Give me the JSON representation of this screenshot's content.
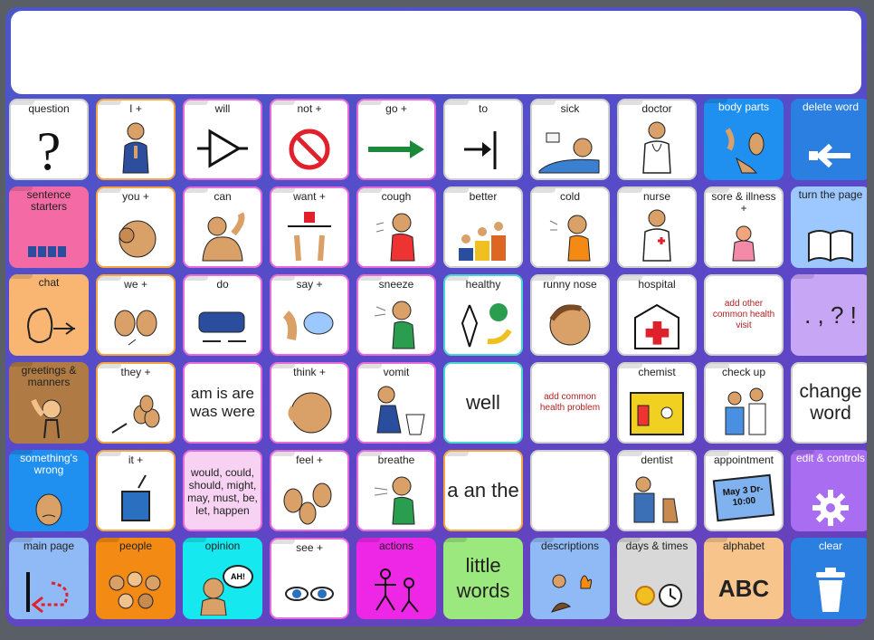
{
  "message_bar": {
    "text": ""
  },
  "cells": {
    "r1": [
      "question",
      "I +",
      "will",
      "not +",
      "go +",
      "to",
      "sick",
      "doctor",
      "body parts",
      "delete word"
    ],
    "r2": [
      "sentence starters",
      "you +",
      "can",
      "want +",
      "cough",
      "better",
      "cold",
      "nurse",
      "sore & illness +",
      "turn the page"
    ],
    "r3": [
      "chat",
      "we +",
      "do",
      "say +",
      "sneeze",
      "healthy",
      "runny nose",
      "hospital",
      "add other common health visit",
      ". , ? !"
    ],
    "r4": [
      "greetings & manners",
      "they +",
      "am is are was were",
      "think +",
      "vomit",
      "well",
      "add common health problem",
      "chemist",
      "check up",
      "change word"
    ],
    "r5": [
      "something's wrong",
      "it +",
      "would, could, should, might, may, must, be, let, happen",
      "feel +",
      "breathe",
      "a an the",
      "",
      "dentist",
      "appointment",
      "edit & controls"
    ],
    "r6": [
      "main page",
      "people",
      "opinion",
      "see +",
      "actions",
      "little words",
      "descriptions",
      "days & times",
      "alphabet",
      "clear"
    ]
  },
  "extra": {
    "appointment_card": "May 3 Dr-10:00",
    "alphabet_big": "ABC",
    "opinion_bubble": "AH!"
  }
}
